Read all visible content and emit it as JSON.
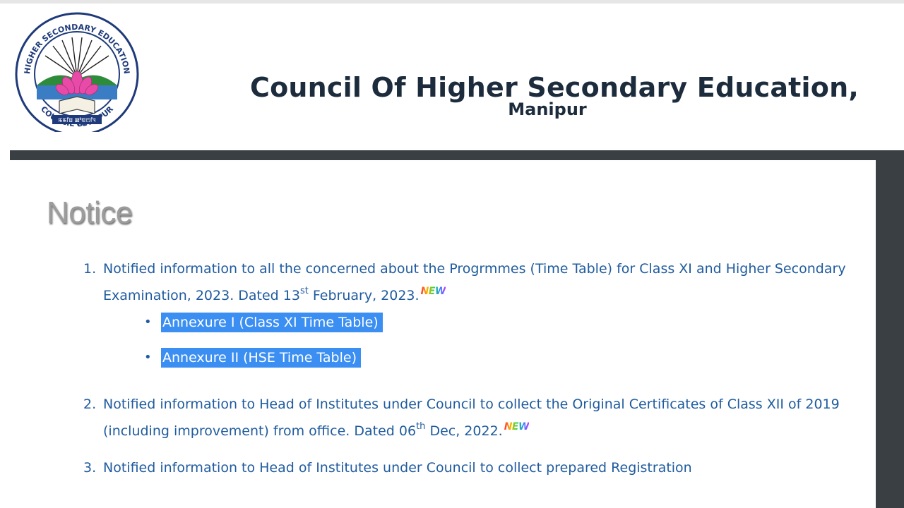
{
  "header": {
    "logo": {
      "ring_text_top": "HIGHER SECONDARY EDUCATION",
      "ring_text_bottom": "COUNCIL OF",
      "ring_text_right": "MANIPUR",
      "banner_text": "ꯃꯃꯤꯡ ꯀꯣꯟꯁꯤꯜ"
    },
    "title": "Council Of Higher Secondary Education,",
    "subtitle": "Manipur"
  },
  "notice": {
    "heading": "Notice",
    "new_badge": "NEW",
    "items": [
      {
        "number": "1.",
        "text_before": "Notified information to all the concerned about the Progrmmes (Time Table) for Class XI and Higher Secondary Examination, 2023. Dated 13",
        "sup": "st",
        "text_after": " February, 2023.",
        "sub_links": [
          {
            "label": "Annexure I (Class XI Time Table)"
          },
          {
            "label": "Annexure II (HSE Time Table)"
          }
        ]
      },
      {
        "number": "2.",
        "text_before": "Notified information to Head of Institutes under Council to collect the Original Certificates of Class XII of 2019 (including improvement) from office. Dated 06",
        "sup": "th",
        "text_after": " Dec, 2022."
      },
      {
        "number": "3.",
        "text_before": "Notified information to Head of Institutes under Council to collect prepared Registration"
      }
    ]
  },
  "colors": {
    "title": "#1c2c3c",
    "link": "#1f5b9e",
    "selection": "#3b8ef2",
    "frame": "#3a3f44"
  }
}
